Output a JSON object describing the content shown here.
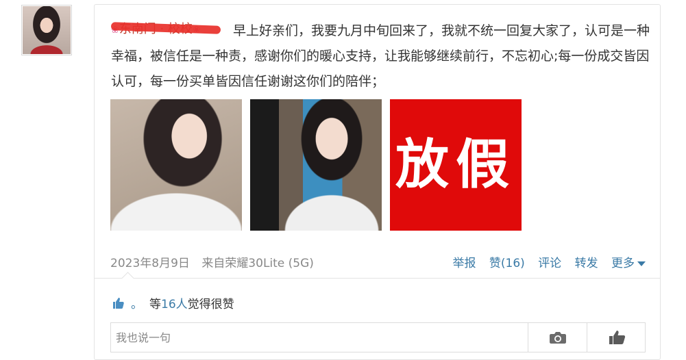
{
  "post": {
    "nickname": "东南门 · 校校",
    "nickname_flower": "❀",
    "text": "早上好亲们，我要九月中旬回来了，我就不统一回复大家了，认可是一种幸福，被信任是一种责，感谢你们的暖心支持，让我能够继续前行，不忘初心;每一份成交皆因认可，每一份买单皆因信任谢谢这你们的陪伴；",
    "image3_text": "放假",
    "date": "2023年8月9日",
    "source": "来自荣耀30Lite (5G)"
  },
  "actions": {
    "report": "举报",
    "like": "赞(16)",
    "comment": "评论",
    "forward": "转发",
    "more": "更多"
  },
  "likes": {
    "dot": "。",
    "prefix": "等",
    "count": "16人",
    "suffix": "觉得很赞"
  },
  "comment": {
    "placeholder": "我也说一句"
  },
  "colors": {
    "link": "#3a7aa6",
    "banner_red": "#e00a0a",
    "strike_red": "#e8302a"
  },
  "icons": [
    "thumbs-up-icon",
    "camera-icon",
    "hand-like-icon",
    "caret-down-icon"
  ]
}
